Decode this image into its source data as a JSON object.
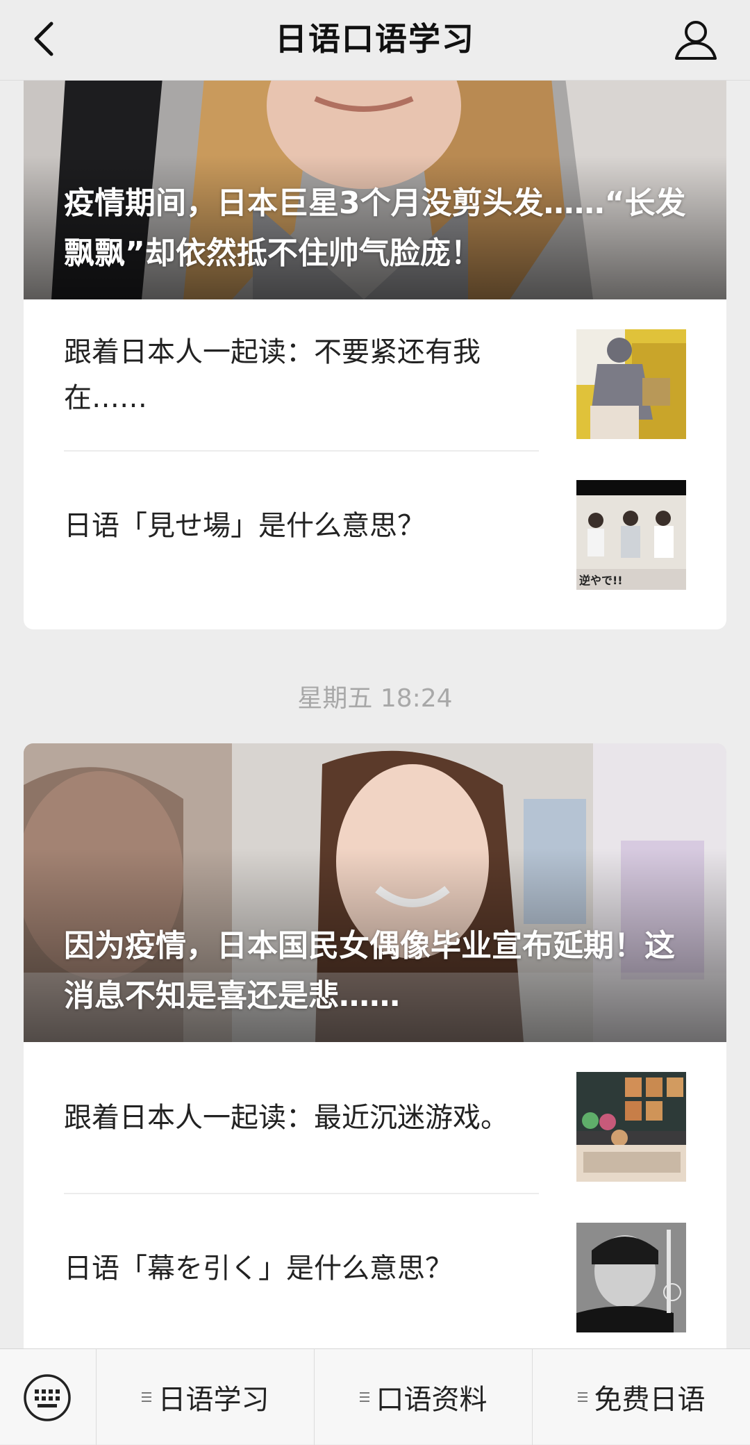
{
  "nav": {
    "title": "日语口语学习",
    "back_icon": "chevron-left-icon",
    "profile_icon": "person-icon"
  },
  "feed": [
    {
      "hero_title": "疫情期间，日本巨星3个月没剪头发……“长发飘飘”却依然抵不住帅气脸庞！",
      "items": [
        {
          "title": "跟着日本人一起读：不要紧还有我在……"
        },
        {
          "title": "日语「見せ場」是什么意思？",
          "thumb_caption": "逆やで!!"
        }
      ]
    },
    {
      "timestamp": "星期五 18:24",
      "hero_title": "因为疫情，日本国民女偶像毕业宣布延期！这消息不知是喜还是悲……",
      "items": [
        {
          "title": "跟着日本人一起读：最近沉迷游戏。"
        },
        {
          "title": "日语「幕を引く」是什么意思？"
        }
      ]
    }
  ],
  "menu": {
    "keyboard_icon": "keyboard-icon",
    "items": [
      {
        "label": "日语学习"
      },
      {
        "label": "口语资料"
      },
      {
        "label": "免费日语"
      }
    ]
  },
  "colors": {
    "page_bg": "#ededed",
    "card_bg": "#ffffff",
    "timestamp": "#a8a8a8",
    "text": "#222222"
  }
}
